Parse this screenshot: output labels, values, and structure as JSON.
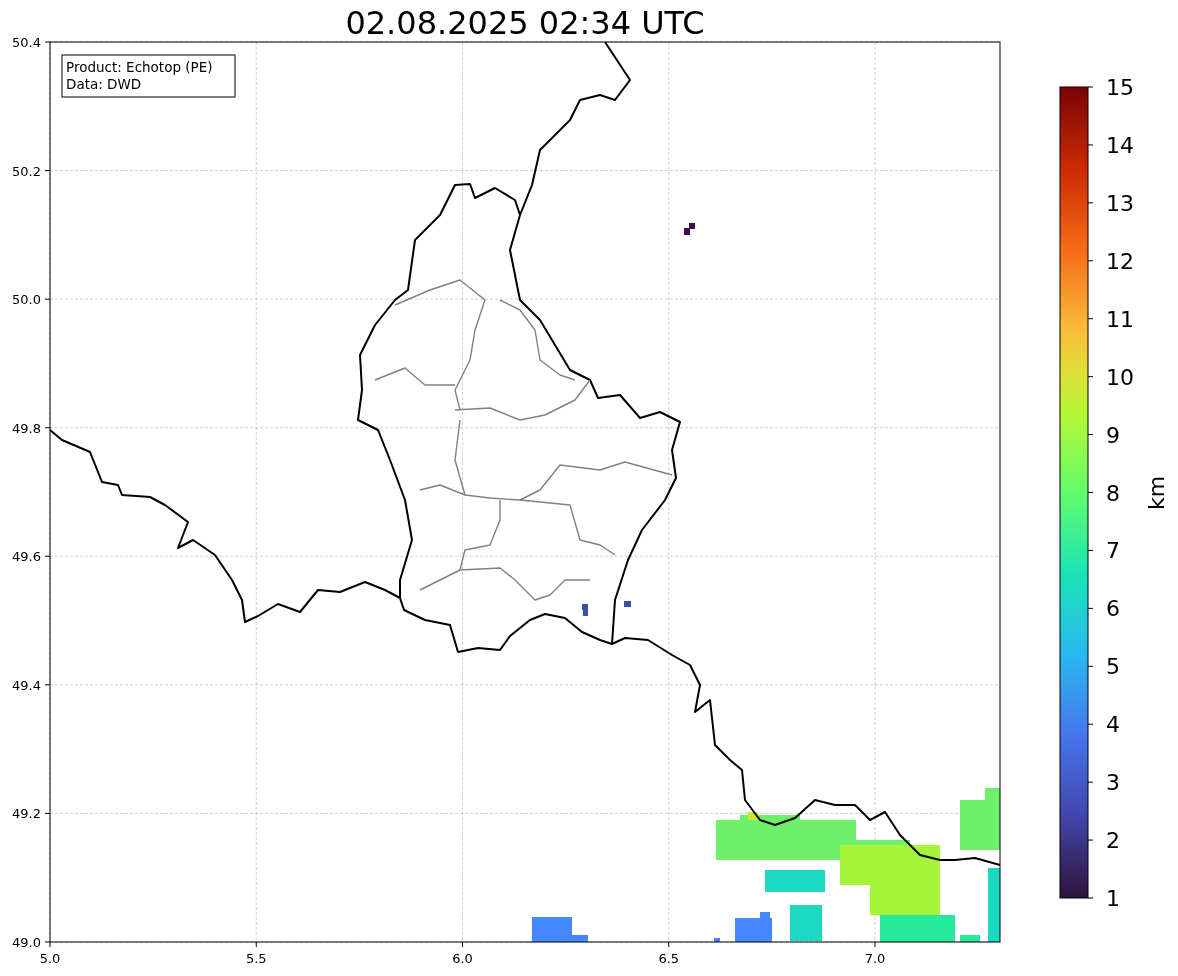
{
  "title": "02.08.2025 02:34 UTC",
  "info_box": [
    "Product: Echotop (PE)",
    "Data: DWD"
  ],
  "x_axis": {
    "ticks": [
      "5.0",
      "5.5",
      "6.0",
      "6.5",
      "7.0"
    ]
  },
  "y_axis": {
    "ticks": [
      "50.4",
      "50.2",
      "50.0",
      "49.8",
      "49.6",
      "49.4",
      "49.2",
      "49.0"
    ]
  },
  "colorbar": {
    "label": "km",
    "ticks": [
      "15",
      "14",
      "13",
      "12",
      "11",
      "10",
      "9",
      "8",
      "7",
      "6",
      "5",
      "4",
      "3",
      "2",
      "1"
    ]
  }
}
